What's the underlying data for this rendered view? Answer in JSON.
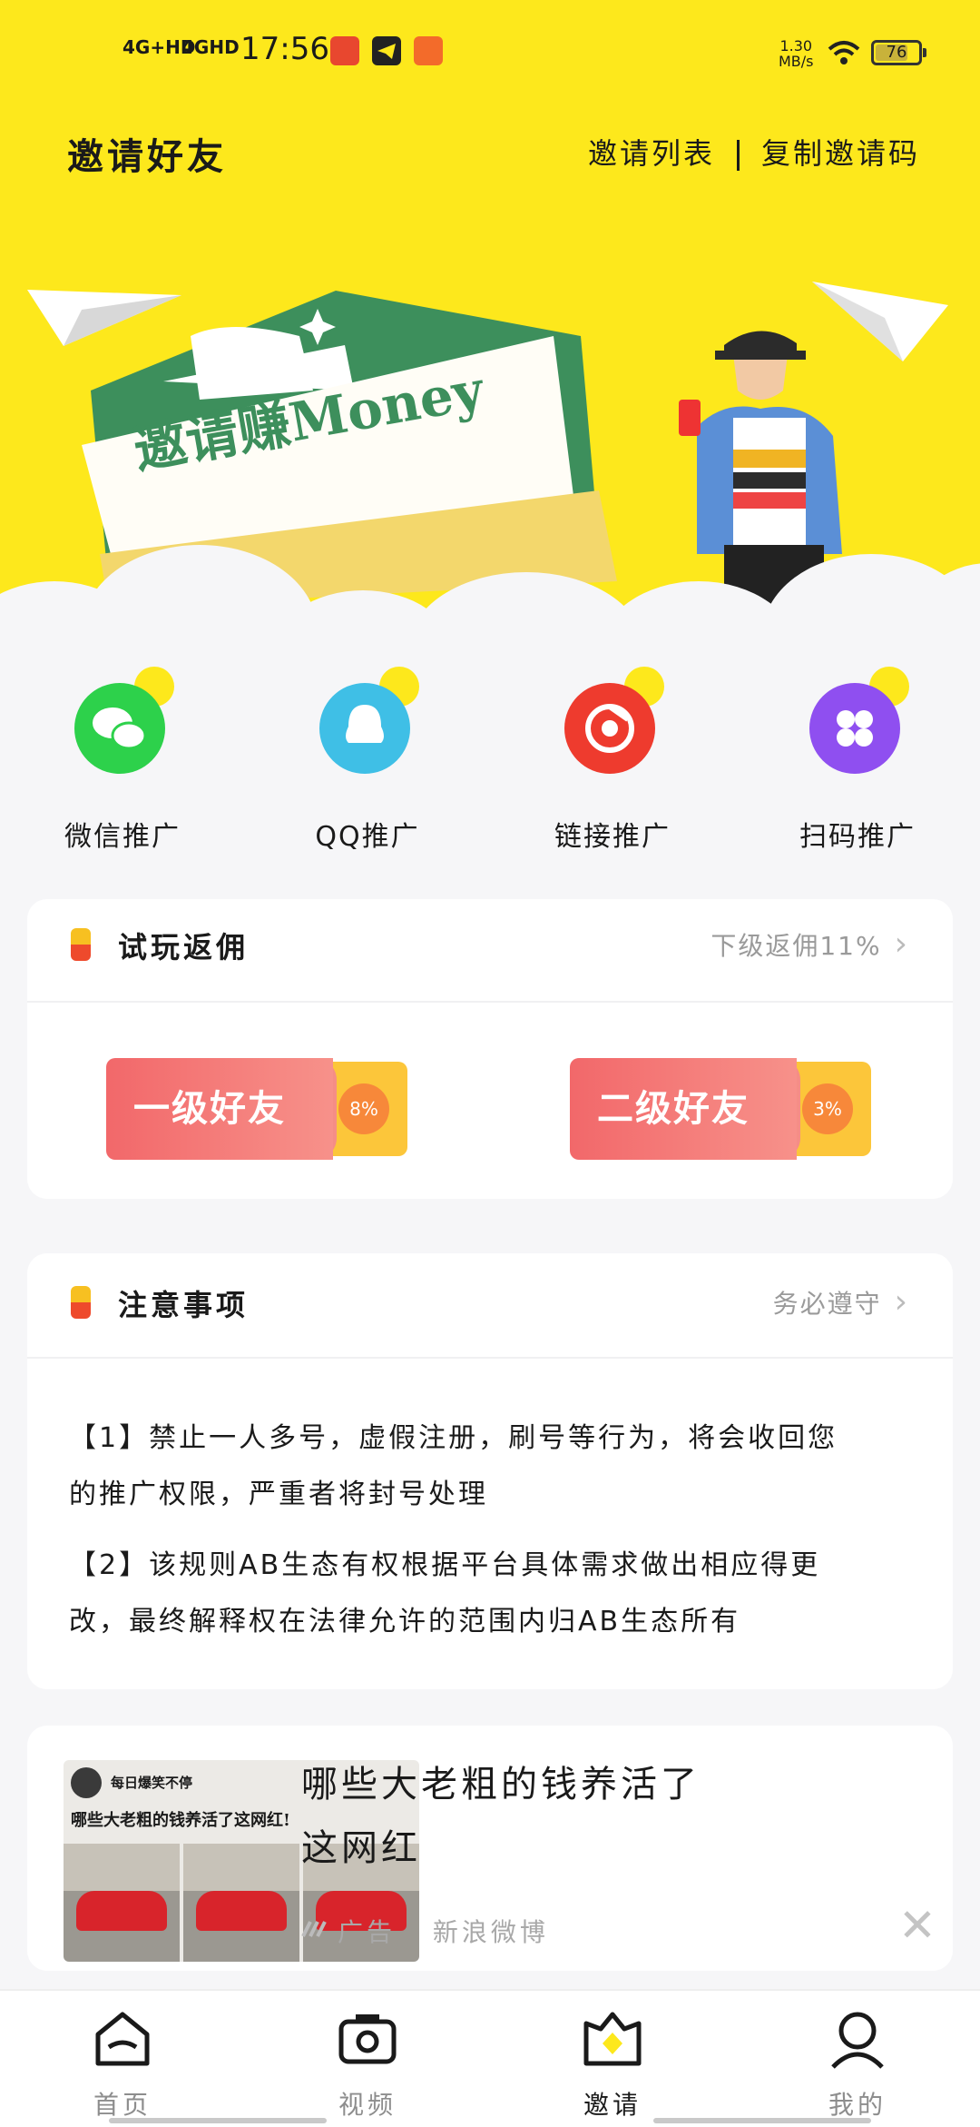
{
  "status_bar": {
    "network_1": "4G+HD",
    "network_2": "4GHD",
    "time": "17:56",
    "speed_value": "1.30",
    "speed_unit": "MB/s",
    "battery": "76",
    "battery_level": 0.76
  },
  "header": {
    "title": "邀请好友",
    "invite_list": "邀请列表",
    "copy_code": "复制邀请码"
  },
  "banner": {
    "text": "邀请赚Money"
  },
  "promo": [
    {
      "label": "微信推广",
      "icon": "wechat-icon",
      "color": "#2dd14b"
    },
    {
      "label": "QQ推广",
      "icon": "qq-icon",
      "color": "#3fbfe6"
    },
    {
      "label": "链接推广",
      "icon": "link-icon",
      "color": "#ee3b2e"
    },
    {
      "label": "扫码推广",
      "icon": "qr-icon",
      "color": "#8f4ff0"
    }
  ],
  "trial": {
    "title": "试玩返佣",
    "more": "下级返佣11%",
    "level1": {
      "label": "一级好友",
      "rate": "8%"
    },
    "level2": {
      "label": "二级好友",
      "rate": "3%"
    }
  },
  "notice": {
    "title": "注意事项",
    "more": "务必遵守",
    "rule1_line1": "【1】禁止一人多号，虚假注册，刷号等行为，将会收回您",
    "rule1_line2": "的推广权限，严重者将封号处理",
    "rule2_line1": "【2】该规则AB生态有权根据平台具体需求做出相应得更",
    "rule2_line2": "改，最终解释权在法律允许的范围内归AB生态所有"
  },
  "news": {
    "thumb_source": "每日爆笑不停",
    "thumb_caption": "哪些大老粗的钱养活了这网红!",
    "headline_line1": "哪些大老粗的钱养活了",
    "headline_line2": "这网红",
    "ad_label": "广告",
    "source": "新浪微博"
  },
  "tabs": [
    {
      "label": "首页",
      "icon": "home-icon"
    },
    {
      "label": "视频",
      "icon": "camera-icon"
    },
    {
      "label": "邀请",
      "icon": "invite-icon"
    },
    {
      "label": "我的",
      "icon": "profile-icon"
    }
  ],
  "colors": {
    "brand_yellow": "#fde81c",
    "ticket_red": "#f2686a",
    "ticket_gold": "#fcc63a"
  }
}
